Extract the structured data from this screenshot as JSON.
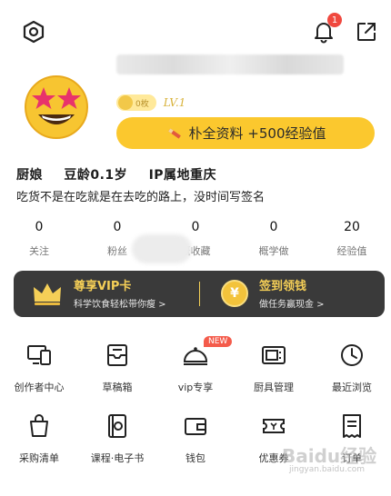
{
  "header": {
    "notification_count": "1"
  },
  "profile": {
    "level_badge": "0枚",
    "level": "LV.1",
    "complete_button": "朴全资料 +500经验值"
  },
  "bio": {
    "role": "厨娘",
    "age": "豆龄0.1岁",
    "ip": "IP属地重庆",
    "signature": "吃货不是在吃就是在去吃的路上，没时间写签名"
  },
  "stats": [
    {
      "value": "0",
      "label": "关注"
    },
    {
      "value": "0",
      "label": "粉丝"
    },
    {
      "value": "0",
      "label": "概收藏"
    },
    {
      "value": "0",
      "label": "概学做"
    },
    {
      "value": "20",
      "label": "经验值"
    }
  ],
  "vip_banner": {
    "vip_title": "尊享VIP卡",
    "vip_subtitle": "科学饮食轻松带你瘦 >",
    "signin_title": "签到领钱",
    "signin_subtitle": "做任务赢现金 >",
    "coin_symbol": "¥"
  },
  "grid": [
    {
      "label": "创作者中心",
      "icon": "creator-center-icon"
    },
    {
      "label": "草稿箱",
      "icon": "drafts-icon"
    },
    {
      "label": "vip专享",
      "icon": "vip-exclusive-icon",
      "tag": "NEW"
    },
    {
      "label": "厨具管理",
      "icon": "kitchenware-icon"
    },
    {
      "label": "最近浏览",
      "icon": "recent-history-icon"
    },
    {
      "label": "采购清单",
      "icon": "shopping-list-icon"
    },
    {
      "label": "课程·电子书",
      "icon": "courses-ebook-icon"
    },
    {
      "label": "钱包",
      "icon": "wallet-icon"
    },
    {
      "label": "优惠券",
      "icon": "coupon-icon"
    },
    {
      "label": "订单",
      "icon": "orders-icon"
    }
  ],
  "watermark": {
    "text": "Baidu经验",
    "sub": "jingyan.baidu.com"
  },
  "colors": {
    "accent": "#fbc82e",
    "badge": "#f0483e",
    "banner_bg": "#3a3a3a",
    "gold": "#f5cf57"
  }
}
